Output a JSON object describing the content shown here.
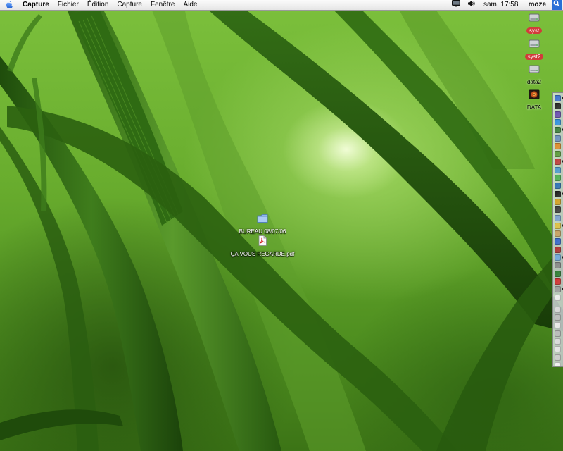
{
  "menubar": {
    "apple_icon": "apple-icon",
    "app_name": "Capture",
    "items": [
      "Fichier",
      "Édition",
      "Capture",
      "Fenêtre",
      "Aide"
    ],
    "clock": "sam. 17:58",
    "user": "moze",
    "extras": [
      "display-icon",
      "volume-icon",
      "spotlight-icon"
    ]
  },
  "desktop": {
    "volumes": [
      {
        "label": "syst",
        "icon": "hard-drive-icon"
      },
      {
        "label": "syst2",
        "icon": "hard-drive-icon"
      },
      {
        "label": "data2",
        "icon": "hard-drive-icon"
      },
      {
        "label": "DATA",
        "icon": "disk-image-icon"
      }
    ],
    "items": [
      {
        "label": "BUREAU 08/07/06",
        "icon": "folder-icon"
      },
      {
        "label": "ÇA VOUS REGARDE.pdf",
        "icon": "pdf-document-icon"
      }
    ]
  },
  "dock": {
    "position": "right",
    "item_colors": [
      "#3a6fd0",
      "#222222",
      "#6a4bb0",
      "#2f8fe0",
      "#3a7d3a",
      "#6a8fc0",
      "#e08a2a",
      "#5a9a3a",
      "#c03a3a",
      "#4a9ad0",
      "#4caf50",
      "#2b6fb8",
      "#1a1a1a",
      "#d4a020",
      "#3a3a3a",
      "#7aa0d0",
      "#e0c040",
      "#c8a060",
      "#3366cc",
      "#b03030",
      "#6fa8dc",
      "#888888",
      "#2e7d32",
      "#d32f2f",
      "#9e9e9e",
      "#f0f0f0",
      "#dcdcdc",
      "#c0c0c0",
      "#eeeeee",
      "#bbbbbb",
      "#dddddd",
      "#e8e8e8",
      "#cfcfcf",
      "#f4f4f4"
    ]
  },
  "colors": {
    "menubar": "#eeeeee",
    "volume_label_bg": "#d23b3b",
    "spotlight": "#2a6fd6"
  }
}
